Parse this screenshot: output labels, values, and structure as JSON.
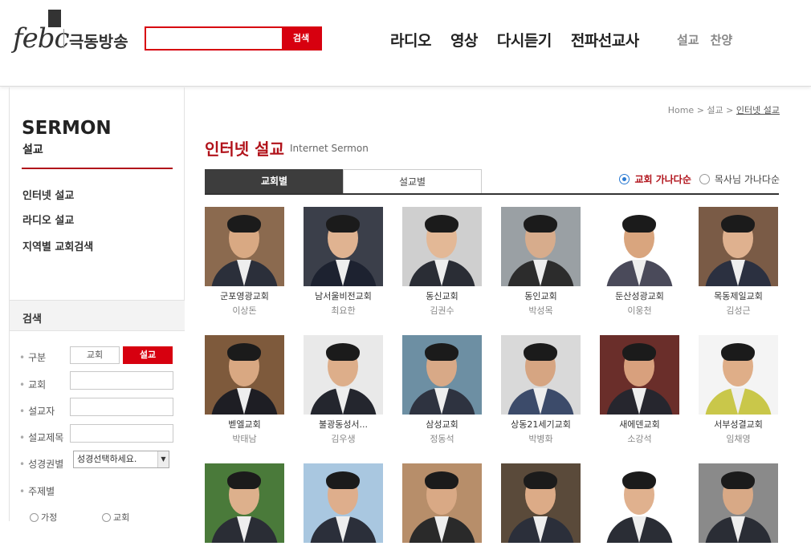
{
  "header": {
    "logo_text": "febc",
    "logo_name": "극동방송",
    "search": {
      "placeholder": "",
      "button": "검색"
    },
    "nav": [
      "라디오",
      "영상",
      "다시듣기",
      "전파선교사"
    ],
    "subnav": [
      "설교",
      "찬양"
    ]
  },
  "sidebar": {
    "title": "SERMON",
    "subtitle": "설교",
    "menu": [
      "인터넷 설교",
      "라디오 설교",
      "지역별 교회검색"
    ],
    "search": {
      "title": "검색",
      "type_label": "구분",
      "type_church": "교회",
      "type_sermon": "설교",
      "church_label": "교회",
      "preacher_label": "설교자",
      "subject_label": "설교제목",
      "bible_label": "성경권별",
      "bible_select": "성경선택하세요.",
      "topic_label": "주제별",
      "topics": [
        "가정",
        "교회"
      ]
    }
  },
  "breadcrumb": {
    "home": "Home",
    "sep": ">",
    "level1": "설교",
    "current": "인터넷 설교"
  },
  "page": {
    "title": "인터넷 설교",
    "title_en": "Internet Sermon",
    "tabs": [
      "교회별",
      "설교별"
    ],
    "sort": [
      "교회 가나다순",
      "목사님 가나다순"
    ],
    "sort_active": 0
  },
  "cards": [
    {
      "church": "군포영광교회",
      "pastor": "이상돈",
      "bg": "#8b6a4f",
      "suit": "#2b2f3a",
      "skin": "#d9a983"
    },
    {
      "church": "남서울비전교회",
      "pastor": "최요한",
      "bg": "#3b3f4a",
      "suit": "#1d2230",
      "skin": "#e0b391"
    },
    {
      "church": "동신교회",
      "pastor": "김권수",
      "bg": "#cfcfcf",
      "suit": "#2a2d35",
      "skin": "#e3b896"
    },
    {
      "church": "동인교회",
      "pastor": "박성목",
      "bg": "#9aa0a4",
      "suit": "#2c2c2c",
      "skin": "#d7ac8c"
    },
    {
      "church": "둔산성광교회",
      "pastor": "이웅천",
      "bg": "#ffffff",
      "suit": "#4a4a5a",
      "skin": "#d9a57e"
    },
    {
      "church": "목동제일교회",
      "pastor": "김성근",
      "bg": "#7a5b46",
      "suit": "#2b3040",
      "skin": "#dfb18f"
    },
    {
      "church": "벧엘교회",
      "pastor": "박태남",
      "bg": "#7e5a3c",
      "suit": "#1e1e24",
      "skin": "#d9a882"
    },
    {
      "church": "불광동성서...",
      "pastor": "김우생",
      "bg": "#e9e9e9",
      "suit": "#24262e",
      "skin": "#ddae8a"
    },
    {
      "church": "삼성교회",
      "pastor": "정동석",
      "bg": "#6d8fa3",
      "suit": "#2e3340",
      "skin": "#d8a987"
    },
    {
      "church": "상동21세기교회",
      "pastor": "박병화",
      "bg": "#d9d9d9",
      "suit": "#3c4b6a",
      "skin": "#d6a582"
    },
    {
      "church": "새에덴교회",
      "pastor": "소강석",
      "bg": "#6a2e2a",
      "suit": "#26262e",
      "skin": "#d8a07d"
    },
    {
      "church": "서부성결교회",
      "pastor": "임채영",
      "bg": "#f4f4f4",
      "suit": "#c9c74a",
      "skin": "#dfae88"
    },
    {
      "church": "",
      "pastor": "",
      "bg": "#4a7a3a",
      "suit": "#2a2d35",
      "skin": "#ddb08c"
    },
    {
      "church": "",
      "pastor": "",
      "bg": "#a9c7e0",
      "suit": "#2b2f3a",
      "skin": "#deae8c"
    },
    {
      "church": "",
      "pastor": "",
      "bg": "#b78e6a",
      "suit": "#2a2a2a",
      "skin": "#d9a985"
    },
    {
      "church": "",
      "pastor": "",
      "bg": "#5a4a3a",
      "suit": "#2b2f3a",
      "skin": "#dcab87"
    },
    {
      "church": "",
      "pastor": "",
      "bg": "#ffffff",
      "suit": "#2a2d35",
      "skin": "#e0b18e"
    },
    {
      "church": "",
      "pastor": "",
      "bg": "#8a8a8a",
      "suit": "#2a2d35",
      "skin": "#d8a986"
    }
  ]
}
